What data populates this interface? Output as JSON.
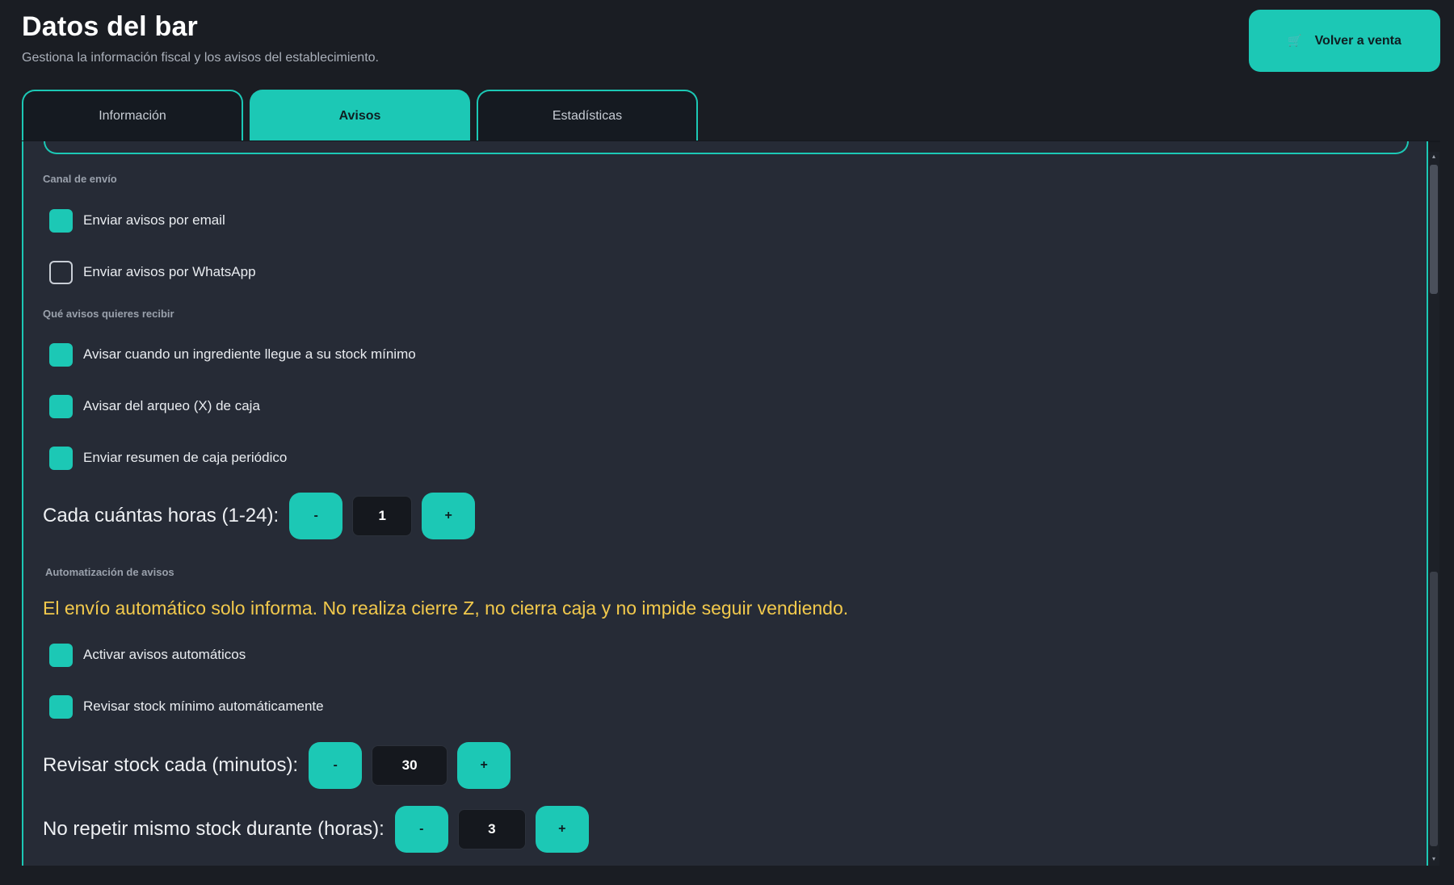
{
  "header": {
    "title": "Datos del bar",
    "subtitle": "Gestiona la información fiscal y los avisos del establecimiento."
  },
  "back_button": {
    "label": "Volver a venta",
    "icon": "cart-icon"
  },
  "tabs": [
    {
      "label": "Información",
      "active": false
    },
    {
      "label": "Avisos",
      "active": true
    },
    {
      "label": "Estadísticas",
      "active": false
    }
  ],
  "channel": {
    "section_label": "Canal de envío",
    "options": [
      {
        "label": "Enviar avisos por email",
        "checked": true
      },
      {
        "label": "Enviar avisos por WhatsApp",
        "checked": false
      }
    ]
  },
  "alerts": {
    "section_label": "Qué avisos quieres recibir",
    "options": [
      {
        "label": "Avisar cuando un ingrediente llegue a su stock mínimo",
        "checked": true
      },
      {
        "label": "Avisar del arqueo (X) de caja",
        "checked": true
      },
      {
        "label": "Enviar resumen de caja periódico",
        "checked": true
      }
    ],
    "hours_stepper": {
      "label": "Cada cuántas horas (1-24):",
      "value": "1",
      "minus": "-",
      "plus": "+"
    }
  },
  "automation": {
    "section_label": "Automatización de avisos",
    "warning": "El envío automático solo informa. No realiza cierre Z, no cierra caja y no impide seguir vendiendo.",
    "options": [
      {
        "label": "Activar avisos automáticos",
        "checked": true
      },
      {
        "label": "Revisar stock mínimo automáticamente",
        "checked": true
      }
    ],
    "stock_minutes_stepper": {
      "label": "Revisar stock cada (minutos):",
      "value": "30",
      "minus": "-",
      "plus": "+"
    },
    "no_repeat_stepper": {
      "label": "No repetir mismo stock durante (horas):",
      "value": "3",
      "minus": "-",
      "plus": "+"
    }
  },
  "colors": {
    "accent": "#1cc8b5",
    "background": "#1a1d23",
    "panel": "#262b36",
    "warning": "#f2c94c"
  }
}
